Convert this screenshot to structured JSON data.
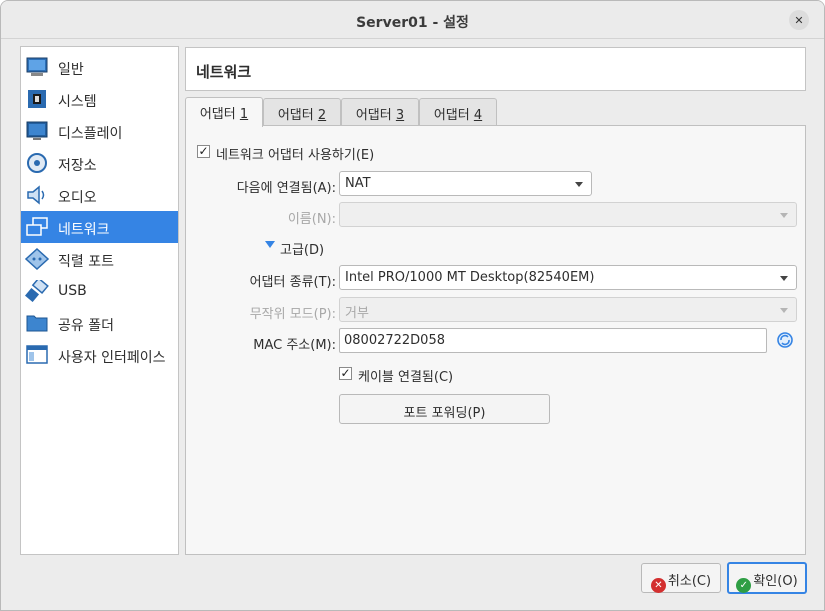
{
  "window": {
    "title": "Server01 - 설정"
  },
  "sidebar": {
    "items": [
      {
        "label": "일반",
        "icon": "general-monitor-icon"
      },
      {
        "label": "시스템",
        "icon": "chip-icon"
      },
      {
        "label": "디스플레이",
        "icon": "display-monitor-icon"
      },
      {
        "label": "저장소",
        "icon": "storage-disk-icon"
      },
      {
        "label": "오디오",
        "icon": "speaker-icon"
      },
      {
        "label": "네트워크",
        "icon": "network-icon",
        "selected": true
      },
      {
        "label": "직렬 포트",
        "icon": "serial-port-icon"
      },
      {
        "label": "USB",
        "icon": "usb-icon"
      },
      {
        "label": "공유 폴더",
        "icon": "folder-icon"
      },
      {
        "label": "사용자 인터페이스",
        "icon": "ui-window-icon"
      }
    ]
  },
  "header": {
    "title": "네트워크"
  },
  "tabs": [
    {
      "label": "어댑터",
      "num": "1"
    },
    {
      "label": "어댑터",
      "num": "2"
    },
    {
      "label": "어댑터",
      "num": "3"
    },
    {
      "label": "어댑터",
      "num": "4"
    }
  ],
  "adapter": {
    "enable_label": "네트워크 어댑터 사용하기(E)",
    "enable_checked": true,
    "attached_label": "다음에 연결됨(A):",
    "attached_value": "NAT",
    "name_label": "이름(N):",
    "name_value": "",
    "advanced_label": "고급(D)",
    "type_label": "어댑터 종류(T):",
    "type_value": "Intel PRO/1000 MT Desktop(82540EM)",
    "promisc_label": "무작위 모드(P):",
    "promisc_value": "거부",
    "mac_label": "MAC 주소(M):",
    "mac_value": "08002722D058",
    "cable_label": "케이블 연결됨(C)",
    "cable_checked": true,
    "port_forwarding_label": "포트 포워딩(P)"
  },
  "footer": {
    "cancel_label": "취소(C)",
    "ok_label": "확인(O)"
  },
  "colors": {
    "accent": "#3584e4",
    "cancel": "#d32f2f",
    "ok": "#2e9e44"
  }
}
